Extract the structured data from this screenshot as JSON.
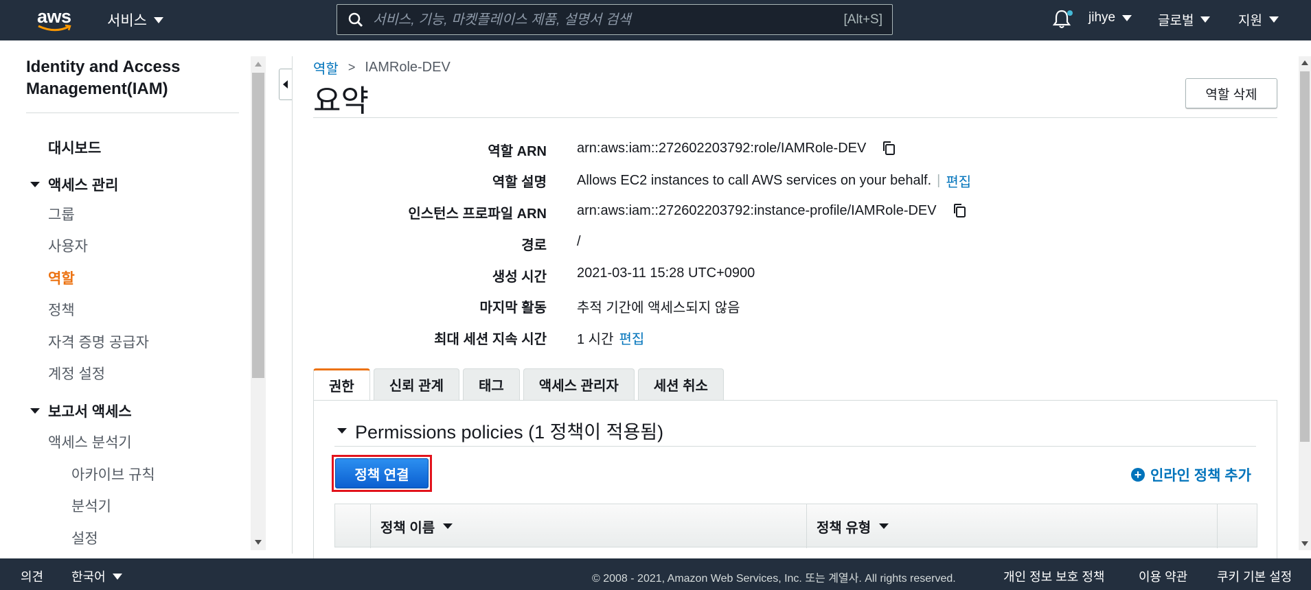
{
  "topnav": {
    "logo_text": "aws",
    "services_label": "서비스",
    "search_placeholder": "서비스, 기능, 마켓플레이스 제품, 설명서 검색",
    "search_shortcut": "[Alt+S]",
    "user_label": "jihye",
    "region_label": "글로벌",
    "support_label": "지원"
  },
  "sidebar": {
    "title": "Identity and Access Management(IAM)",
    "dashboard": "대시보드",
    "access_management": {
      "label": "액세스 관리",
      "items": [
        "그룹",
        "사용자",
        "역할",
        "정책",
        "자격 증명 공급자",
        "계정 설정"
      ],
      "active": "역할"
    },
    "access_reports": {
      "label": "보고서 액세스",
      "items": [
        "액세스 분석기",
        "아카이브 규칙",
        "분석기",
        "설정"
      ]
    }
  },
  "main": {
    "breadcrumb": {
      "parent": "역할",
      "current": "IAMRole-DEV"
    },
    "title": "요약",
    "delete_button": "역할 삭제",
    "summary": [
      {
        "label": "역할 ARN",
        "value": "arn:aws:iam::272602203792:role/IAMRole-DEV",
        "copy": true
      },
      {
        "label": "역할 설명",
        "value": "Allows EC2 instances to call AWS services on your behalf.",
        "link": "편집",
        "separator": "|"
      },
      {
        "label": "인스턴스 프로파일 ARN",
        "value": "arn:aws:iam::272602203792:instance-profile/IAMRole-DEV",
        "copy": true
      },
      {
        "label": "경로",
        "value": "/"
      },
      {
        "label": "생성 시간",
        "value": "2021-03-11 15:28 UTC+0900"
      },
      {
        "label": "마지막 활동",
        "value": "추적 기간에 액세스되지 않음"
      },
      {
        "label": "최대 세션 지속 시간",
        "value": "1 시간",
        "link": "편집"
      }
    ],
    "tabs": [
      "권한",
      "신뢰 관계",
      "태그",
      "액세스 관리자",
      "세션 취소"
    ],
    "active_tab": "권한",
    "permissions": {
      "header": "Permissions policies (1 정책이 적용됨)",
      "attach_button": "정책 연결",
      "add_inline": "인라인 정책 추가",
      "table_headers": [
        "정책 이름",
        "정책 유형"
      ]
    }
  },
  "footer": {
    "feedback": "의견",
    "language": "한국어",
    "copyright": "© 2008 - 2021, Amazon Web Services, Inc. 또는 계열사. All rights reserved.",
    "privacy": "개인 정보 보호 정책",
    "terms": "이용 약관",
    "cookies": "쿠키 기본 설정"
  },
  "colors": {
    "nav_bg": "#232f3e",
    "link": "#0073bb",
    "active_orange": "#ec7211",
    "primary_button": "#0b5fd0",
    "highlight_red": "#e2131c"
  }
}
